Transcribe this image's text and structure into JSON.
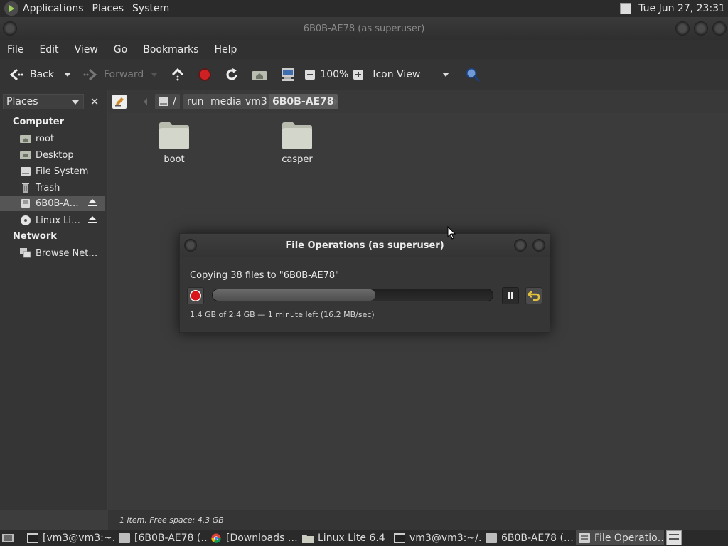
{
  "top_panel": {
    "menus": [
      "Applications",
      "Places",
      "System"
    ],
    "clock": "Tue Jun 27, 23:31"
  },
  "window": {
    "title": "6B0B-AE78 (as superuser)",
    "menubar": [
      "File",
      "Edit",
      "View",
      "Go",
      "Bookmarks",
      "Help"
    ],
    "toolbar": {
      "back": "Back",
      "forward": "Forward",
      "zoom": "100%",
      "view_mode": "Icon View"
    }
  },
  "sidebar": {
    "header": "Places",
    "sections": [
      {
        "title": "Computer",
        "items": [
          {
            "label": "root",
            "icon": "home-folder-icon"
          },
          {
            "label": "Desktop",
            "icon": "desktop-folder-icon"
          },
          {
            "label": "File System",
            "icon": "drive-icon"
          },
          {
            "label": "Trash",
            "icon": "trash-icon"
          },
          {
            "label": "6B0B-A…",
            "icon": "usb-drive-icon",
            "selected": true,
            "eject": true
          },
          {
            "label": "Linux Li…",
            "icon": "disc-icon",
            "eject": true
          }
        ]
      },
      {
        "title": "Network",
        "items": [
          {
            "label": "Browse Net…",
            "icon": "network-icon"
          }
        ]
      }
    ]
  },
  "breadcrumb": {
    "root": "/",
    "segments": [
      "run",
      "media",
      "vm3",
      "6B0B-AE78"
    ]
  },
  "files": [
    {
      "name": "boot",
      "icon": "folder-icon"
    },
    {
      "name": "casper",
      "icon": "folder-icon"
    }
  ],
  "status": "1 item, Free space: 4.3 GB",
  "dialog": {
    "title": "File Operations (as superuser)",
    "message": "Copying 38 files to \"6B0B-AE78\"",
    "progress_fraction": 0.58,
    "details": "1.4 GB of 2.4 GB — 1 minute left (16.2 MB/sec)"
  },
  "taskbar": [
    {
      "label": "[vm3@vm3:~…",
      "icon": "terminal-icon"
    },
    {
      "label": "[6B0B-AE78 (…",
      "icon": "file-manager-icon"
    },
    {
      "label": "[Downloads …",
      "icon": "chrome-icon"
    },
    {
      "label": "Linux Lite 6.4",
      "icon": "folder-icon"
    },
    {
      "label": "vm3@vm3:~/…",
      "icon": "terminal-icon"
    },
    {
      "label": "6B0B-AE78 (…",
      "icon": "file-manager-icon"
    },
    {
      "label": "File Operatio…",
      "icon": "file-operations-icon",
      "active": true
    }
  ],
  "colors": {
    "stop_red": "#d9161b",
    "undo_yellow": "#e3c23c",
    "selection": "#555555"
  }
}
